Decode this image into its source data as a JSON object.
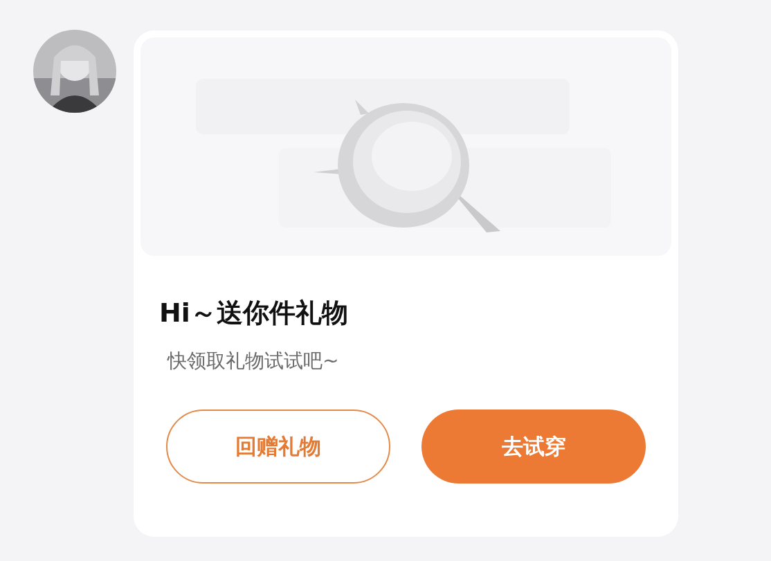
{
  "card": {
    "title": "Hi～送你件礼物",
    "subtitle": "快领取礼物试试吧~",
    "buttons": [
      {
        "label": "回赠礼物",
        "kind": "outline"
      },
      {
        "label": "去试穿",
        "kind": "filled"
      }
    ]
  }
}
